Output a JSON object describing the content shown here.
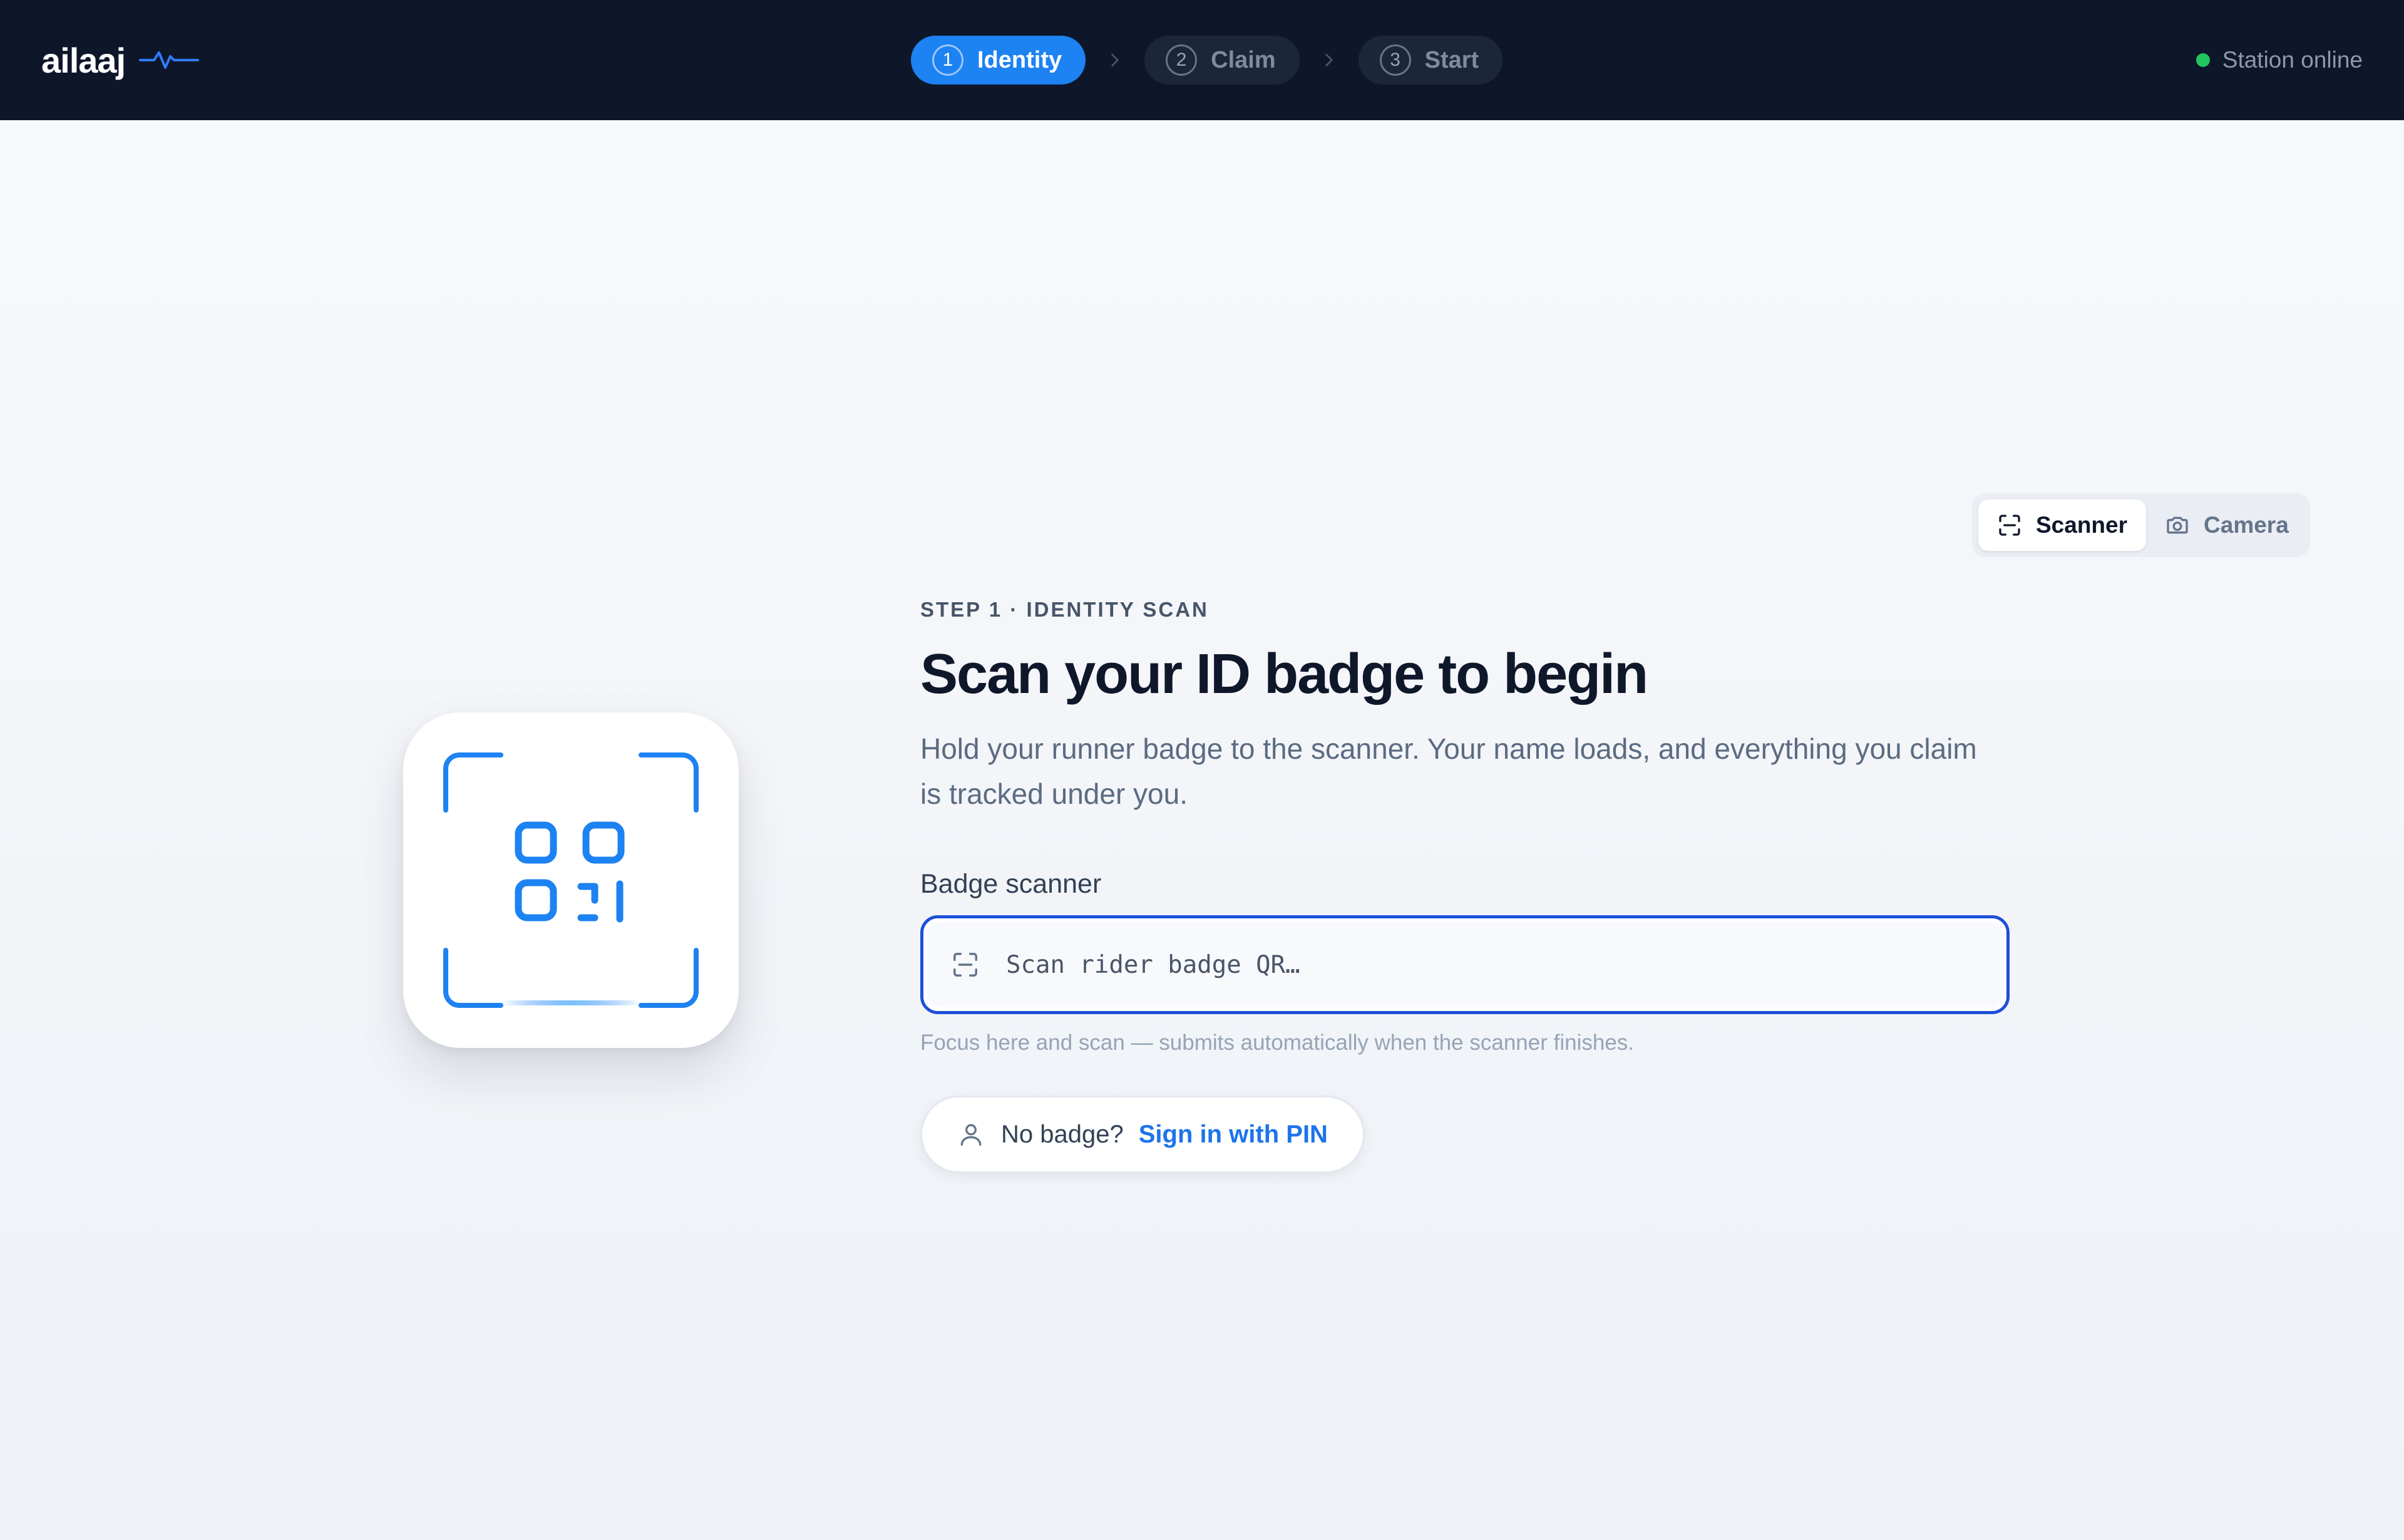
{
  "app": {
    "brand": "ailaaj",
    "brand_icon": "pulse-icon",
    "accent_color": "#1d82f2"
  },
  "stepper": {
    "steps": [
      {
        "number": "1",
        "label": "Identity",
        "state": "active"
      },
      {
        "number": "2",
        "label": "Claim",
        "state": "upcoming"
      },
      {
        "number": "3",
        "label": "Start",
        "state": "upcoming"
      }
    ]
  },
  "status": {
    "label": "Station online",
    "color": "#22c55e"
  },
  "mode_toggle": {
    "options": [
      {
        "label": "Scanner",
        "icon": "scan-frame-icon",
        "selected": true
      },
      {
        "label": "Camera",
        "icon": "camera-icon",
        "selected": false
      }
    ]
  },
  "main": {
    "eyebrow": "STEP 1 · IDENTITY SCAN",
    "title": "Scan your ID badge to begin",
    "description": "Hold your runner badge to the scanner. Your name loads, and everything you claim is tracked under you.",
    "illustration_icon": "qr-code-scan-icon",
    "scanner": {
      "label": "Badge scanner",
      "value": "",
      "placeholder": "Scan rider badge QR…",
      "icon": "scan-frame-icon",
      "hint": "Focus here and scan — submits automatically when the scanner finishes."
    },
    "pin_login": {
      "icon": "user-icon",
      "prefix": "No badge?",
      "link_label": "Sign in with PIN"
    }
  }
}
